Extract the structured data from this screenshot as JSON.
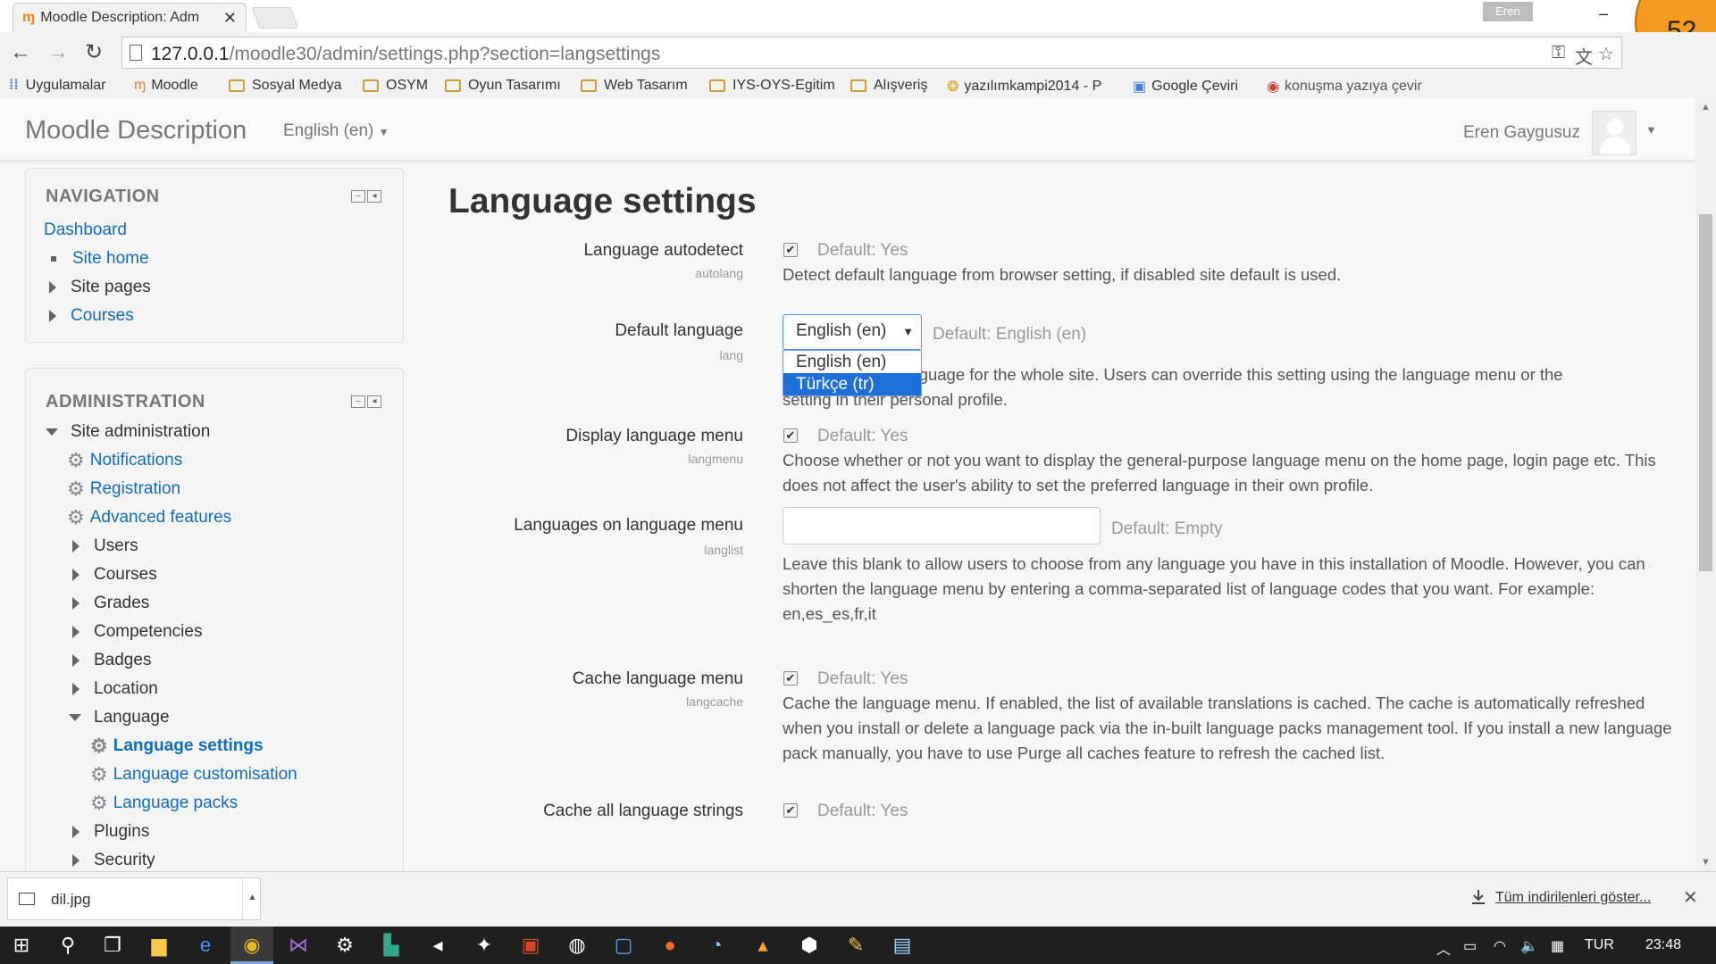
{
  "browser": {
    "tab_title": "Moodle Description: Adm",
    "url_host": "127.0.0.1",
    "url_path": "/moodle30/admin/settings.php?section=langsettings",
    "window_user": "Eren",
    "overlay_badge": "52",
    "bookmarks": [
      {
        "label": "Uygulamalar",
        "icon": "apps-grid-icon"
      },
      {
        "label": "Moodle",
        "icon": "moodle-icon"
      },
      {
        "label": "Sosyal Medya",
        "icon": "folder-icon"
      },
      {
        "label": "OSYM",
        "icon": "folder-icon"
      },
      {
        "label": "Oyun Tasarımı",
        "icon": "folder-icon"
      },
      {
        "label": "Web Tasarım",
        "icon": "folder-icon"
      },
      {
        "label": "IYS-OYS-Egitim",
        "icon": "folder-icon"
      },
      {
        "label": "Alışveriş",
        "icon": "folder-icon"
      },
      {
        "label": "yazılımkampi2014 - P",
        "icon": "cheetah-icon"
      },
      {
        "label": "Google Çeviri",
        "icon": "translate-icon"
      },
      {
        "label": "konuşma yazıya çevir",
        "icon": "chrome-icon"
      }
    ]
  },
  "header": {
    "brand": "Moodle Description",
    "language": "English (en)",
    "username": "Eren Gaygusuz"
  },
  "navigation": {
    "title": "NAVIGATION",
    "items": [
      "Dashboard",
      "Site home",
      "Site pages",
      "Courses"
    ]
  },
  "administration": {
    "title": "ADMINISTRATION",
    "site_admin": "Site administration",
    "items": [
      "Notifications",
      "Registration",
      "Advanced features",
      "Users",
      "Courses",
      "Grades",
      "Competencies",
      "Badges",
      "Location",
      "Language"
    ],
    "language_children": [
      "Language settings",
      "Language customisation",
      "Language packs"
    ],
    "after_items": [
      "Plugins",
      "Security"
    ]
  },
  "main": {
    "heading": "Language settings",
    "settings": [
      {
        "label": "Language autodetect",
        "name": "autolang",
        "checked": true,
        "default": "Default: Yes",
        "description": "Detect default language from browser setting, if disabled site default is used."
      },
      {
        "label": "Default language",
        "name": "lang",
        "selected": "English (en)",
        "options": [
          "English (en)",
          "Türkçe (tr)"
        ],
        "highlighted": "Türkçe (tr)",
        "default": "Default: English (en)",
        "description_part1": "language for the whole site. Users can override this setting using the language menu or the",
        "description_part2": "setting in their personal profile."
      },
      {
        "label": "Display language menu",
        "name": "langmenu",
        "checked": true,
        "default": "Default: Yes",
        "description": "Choose whether or not you want to display the general-purpose language menu on the home page, login page etc. This does not affect the user's ability to set the preferred language in their own profile."
      },
      {
        "label": "Languages on language menu",
        "name": "langlist",
        "value": "",
        "default": "Default: Empty",
        "description": "Leave this blank to allow users to choose from any language you have in this installation of Moodle. However, you can shorten the language menu by entering a comma-separated list of language codes that you want. For example: en,es_es,fr,it"
      },
      {
        "label": "Cache language menu",
        "name": "langcache",
        "checked": true,
        "default": "Default: Yes",
        "description": "Cache the language menu. If enabled, the list of available translations is cached. The cache is automatically refreshed when you install or delete a language pack via the in-built language packs management tool. If you install a new language pack manually, you have to use Purge all caches feature to refresh the cached list."
      },
      {
        "label": "Cache all language strings",
        "name": "",
        "checked": true,
        "default": "Default: Yes",
        "description": ""
      }
    ]
  },
  "downloads": {
    "file": "dil.jpg",
    "show_all": "Tüm indirilenleri göster..."
  },
  "taskbar": {
    "language": "TUR",
    "time": "23:48"
  }
}
